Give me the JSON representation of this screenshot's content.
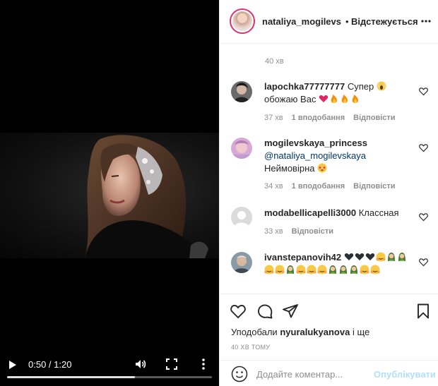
{
  "video": {
    "current_time": "0:50",
    "duration": "1:20",
    "time_separator": " / ",
    "progress_fraction": 0.625
  },
  "header": {
    "username": "nataliya_mogilevs",
    "separator": "•",
    "follow_status": "Відстежується"
  },
  "comments": {
    "previous_time": "40 хв",
    "items": [
      {
        "username": "lapochka77777777",
        "text_1": "Супер",
        "text_2": "обожаю Вас",
        "time": "37 хв",
        "likes": "1 вподобання",
        "reply": "Відповісти",
        "emoji_icons": [
          "screaming-face-icon",
          "red-heart-icon",
          "fire-icon",
          "fire-icon",
          "fire-icon"
        ]
      },
      {
        "username": "mogilevskaya_princess",
        "mention": "@nataliya_mogilevskaya",
        "text": "Неймовірна",
        "time": "34 хв",
        "likes": "1 вподобання",
        "reply": "Відповісти",
        "emoji_icons": [
          "star-struck-icon"
        ]
      },
      {
        "username": "modabellicapelli3000",
        "text": "Классная",
        "time": "33 хв",
        "reply": "Відповісти"
      },
      {
        "username": "ivanstepanovih42",
        "emoji_icons": [
          "black-heart-icon",
          "black-heart-icon",
          "black-heart-icon",
          "hugging-face-icon",
          "woman-elf-icon",
          "woman-elf-icon"
        ]
      }
    ]
  },
  "actions": {
    "liked_by_prefix": "Уподобали",
    "liked_by_user": "nyuralukyanova",
    "liked_by_suffix": "і ще",
    "posted_time": "40 ХВ ТОМУ"
  },
  "composer": {
    "placeholder": "Додайте коментар...",
    "post_label": "Опублікувати"
  },
  "colors": {
    "accent_disabled": "#b2dffc",
    "heart_red": "#ed4956",
    "muted_text": "#8e8e8e",
    "mention_link": "#00376b"
  }
}
